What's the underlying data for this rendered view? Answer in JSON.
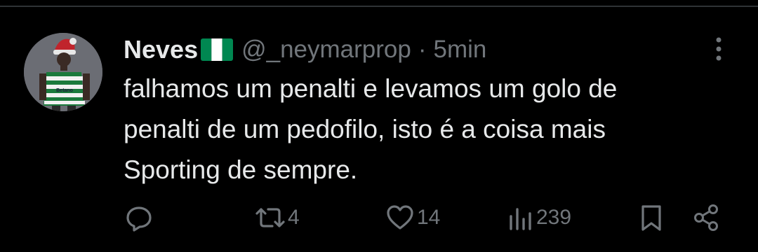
{
  "tweet": {
    "author": {
      "display_name": "Neves",
      "flag": "nigeria-flag-emoji",
      "handle": "@_neymarprop"
    },
    "separator": "·",
    "time": "5min",
    "text_lines": [
      "falhamos um penalti e levamos um golo de",
      "penalti de um pedofilo, isto é a coisa mais",
      "Sporting de sempre."
    ],
    "avatar_shirt_text": "Betano"
  },
  "actions": {
    "reply": {
      "icon": "reply-icon",
      "count": ""
    },
    "retweet": {
      "icon": "retweet-icon",
      "count": "4"
    },
    "like": {
      "icon": "heart-icon",
      "count": "14"
    },
    "views": {
      "icon": "views-icon",
      "count": "239"
    },
    "bookmark": {
      "icon": "bookmark-icon"
    },
    "share": {
      "icon": "share-icon"
    }
  },
  "colors": {
    "background": "#000000",
    "text_primary": "#e7e9ea",
    "text_secondary": "#71767b",
    "divider": "#2f3336",
    "flag_green": "#008751",
    "flag_white": "#ffffff"
  }
}
